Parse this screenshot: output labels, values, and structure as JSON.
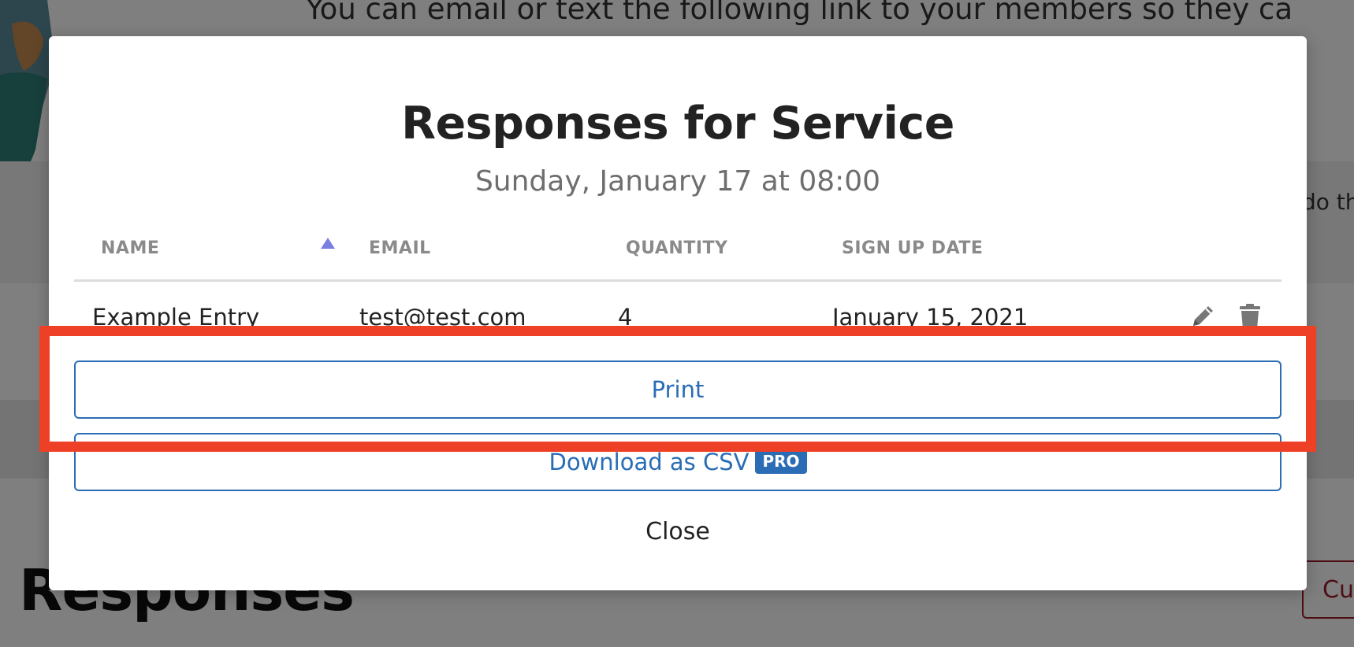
{
  "background": {
    "top_text": "You can email or text the following link to your members so they ca",
    "side_text": "do th",
    "heading": "Responses",
    "side_button_label": "Cus"
  },
  "modal": {
    "title": "Responses for Service",
    "subtitle": "Sunday, January 17 at 08:00",
    "table": {
      "columns": [
        "NAME",
        "EMAIL",
        "QUANTITY",
        "SIGN UP DATE"
      ],
      "sorted_column": "NAME",
      "rows": [
        {
          "name": "Example Entry",
          "email": "test@test.com",
          "quantity": "4",
          "sign_up_date": "January 15, 2021"
        }
      ]
    },
    "print_label": "Print",
    "csv_label": "Download as CSV",
    "pro_badge": "PRO",
    "close_label": "Close"
  },
  "colors": {
    "accent": "#2a6db5",
    "highlight": "#ee4026",
    "sort_indicator": "#7b7fe0"
  },
  "icons": {
    "sort": "sort-ascending-icon",
    "edit": "pencil-icon",
    "delete": "trash-icon"
  }
}
